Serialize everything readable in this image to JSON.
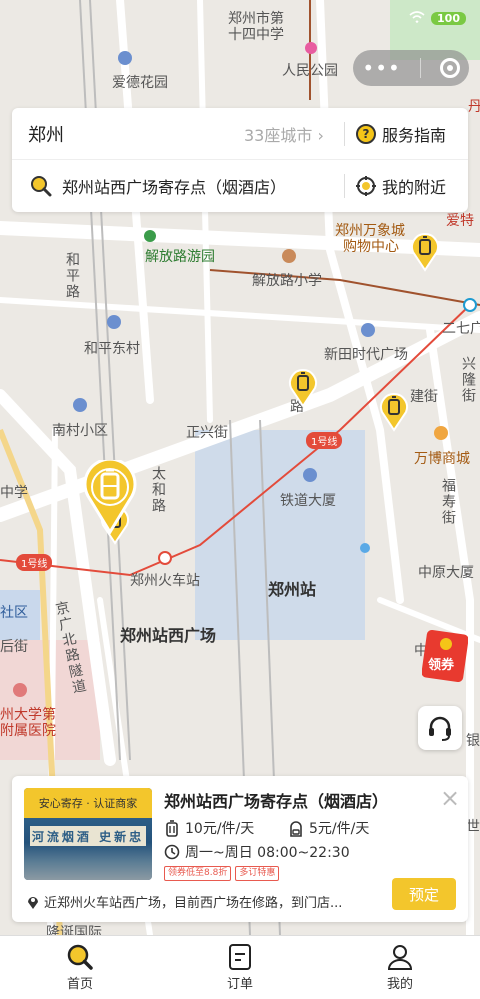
{
  "status": {
    "battery": "100"
  },
  "search": {
    "city": "郑州",
    "city_count": "33座城市",
    "city_arrow": "›",
    "guide_label": "服务指南",
    "guide_icon": "question-icon",
    "query": "郑州站西广场寄存点（烟酒店）",
    "nearby_label": "我的附近"
  },
  "map": {
    "labels": {
      "school14": "郑州市第",
      "school14b": "十四中学",
      "park": "人民公园",
      "aide": "爱德花园",
      "wanxiang": "郑州万象城",
      "wanxiang2": "购物中心",
      "jiefang_park": "解放路游园",
      "jiefang_school": "解放路小学",
      "heping": "和平路",
      "heping_east": "和平东村",
      "xintian": "新田时代广场",
      "nancun": "南村小区",
      "zhengxing": "正兴街",
      "taihe": "太和路",
      "railway_building": "铁道大厦",
      "zhengzhou_station": "郑州站",
      "huoche": "郑州火车站",
      "west_square": "郑州站西广场",
      "jingguang": "京广北路隧道",
      "hospital": "州大学第",
      "hospital2": "附属医院",
      "wanbo": "万博商城",
      "zhongyuan": "中原大厦",
      "fushou": "福寿街",
      "xingyan": "兴隆街",
      "yingjian": "建街",
      "erqi": "二七广",
      "line1_a": "1号线",
      "line1_b": "1号线",
      "dan": "丹",
      "aizhi": "爱特",
      "xue": "中学",
      "shequ": "社区",
      "houjie": "后街",
      "longyun": "隆诞国际",
      "yin": "银",
      "shi": "世",
      "zhong": "中",
      "lu": "路"
    }
  },
  "coupon_label": "领券",
  "card": {
    "badge": "安心寄存 · 认证商家",
    "sign_text": "河流烟酒 史新忠",
    "title": "郑州站西广场寄存点（烟酒店）",
    "close": "×",
    "price_bag": "10元/件/天",
    "price_small": "5元/件/天",
    "hours": "周一~周日 08:00~22:30",
    "tags": [
      "领券低至8.8折",
      "多订特惠"
    ],
    "address": "近郑州火车站西广场，目前西广场在修路，到门店...",
    "reserve_label": "预定"
  },
  "tabs": [
    {
      "label": "首页",
      "icon": "search-icon",
      "active": true
    },
    {
      "label": "订单",
      "icon": "order-icon",
      "active": false
    },
    {
      "label": "我的",
      "icon": "profile-icon",
      "active": false
    }
  ],
  "colors": {
    "accent": "#f3c62c",
    "metro": "#e34b3b"
  }
}
